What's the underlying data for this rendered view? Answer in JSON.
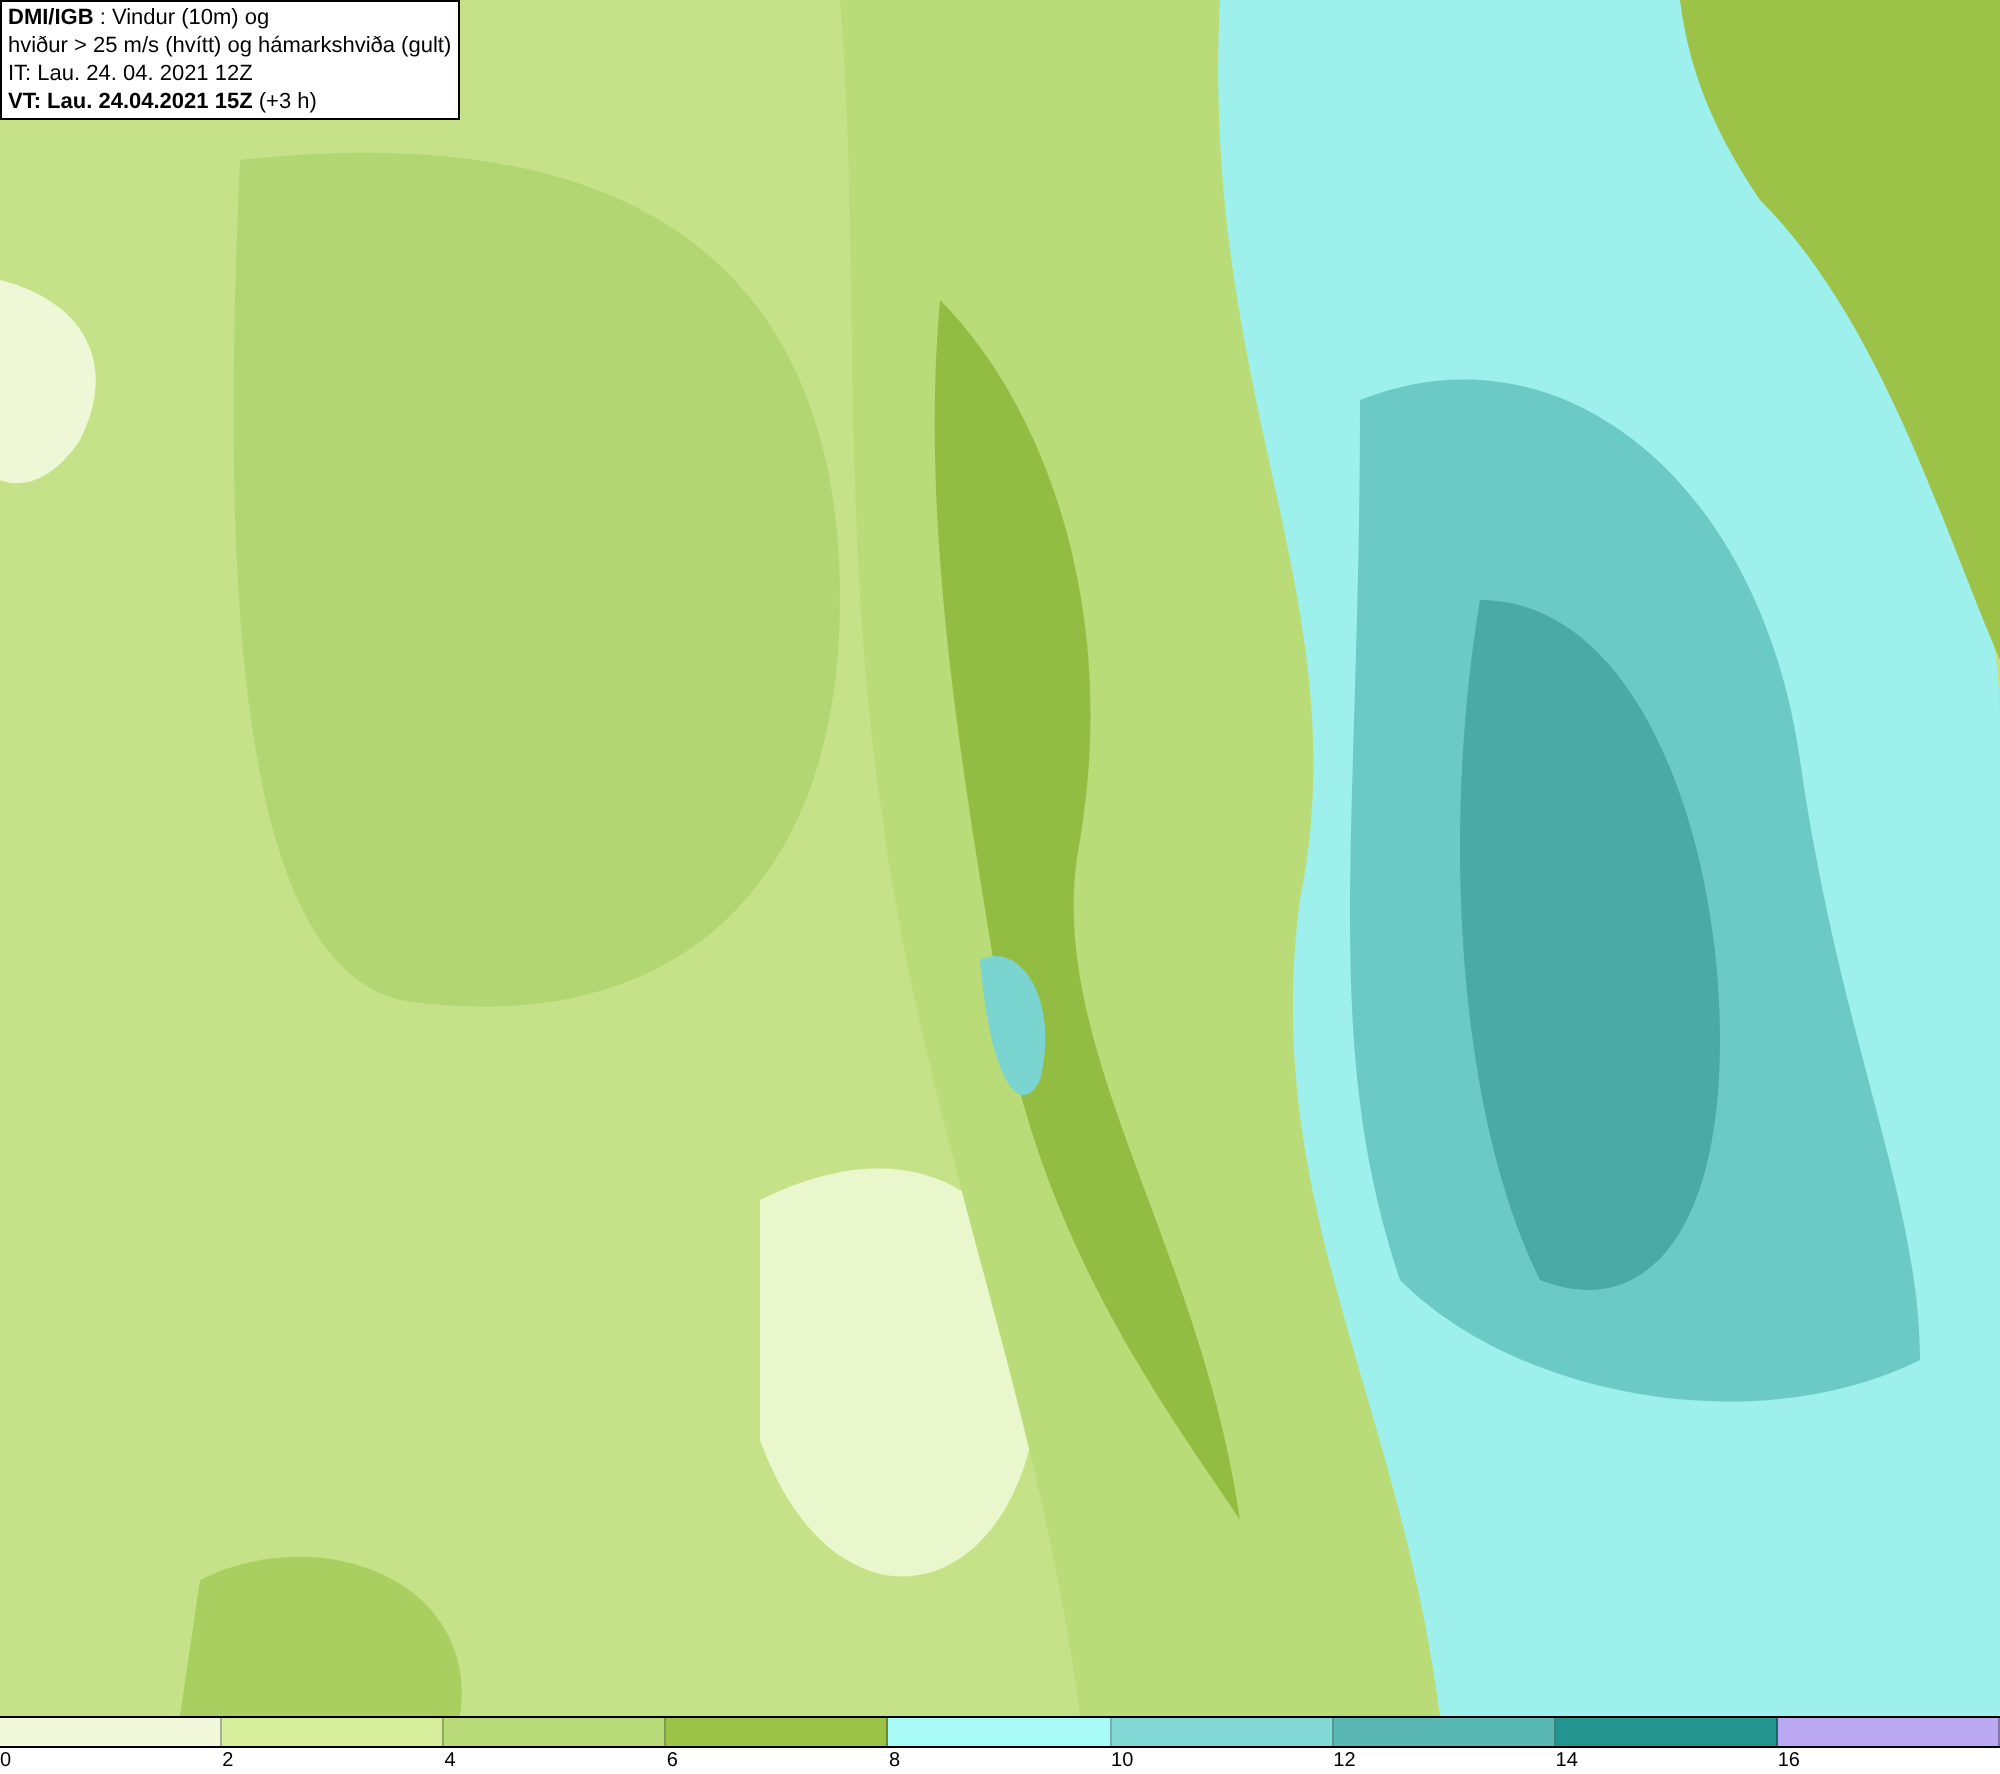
{
  "header": {
    "lines": [
      "**DMI/IGB** : Vindur (10m) og",
      "hviður > 25 m/s (hvítt) og hámarkshviða (gult)",
      "IT: Lau. 24. 04. 2021 12Z",
      "**VT: Lau. 24.04.2021 15Z** (+3 h)"
    ]
  },
  "legend": {
    "bins": [
      {
        "color": "#f2f9da",
        "tick": "0"
      },
      {
        "color": "#d6ee9c",
        "tick": "2"
      },
      {
        "color": "#b9dc78",
        "tick": "4"
      },
      {
        "color": "#9cc348",
        "tick": "6"
      },
      {
        "color": "#a8faf6",
        "tick": "8"
      },
      {
        "color": "#82d8d4",
        "tick": "10"
      },
      {
        "color": "#5ab8b4",
        "tick": "12"
      },
      {
        "color": "#249490",
        "tick": "14"
      },
      {
        "color": "#baa8f2",
        "tick": "16"
      }
    ]
  }
}
